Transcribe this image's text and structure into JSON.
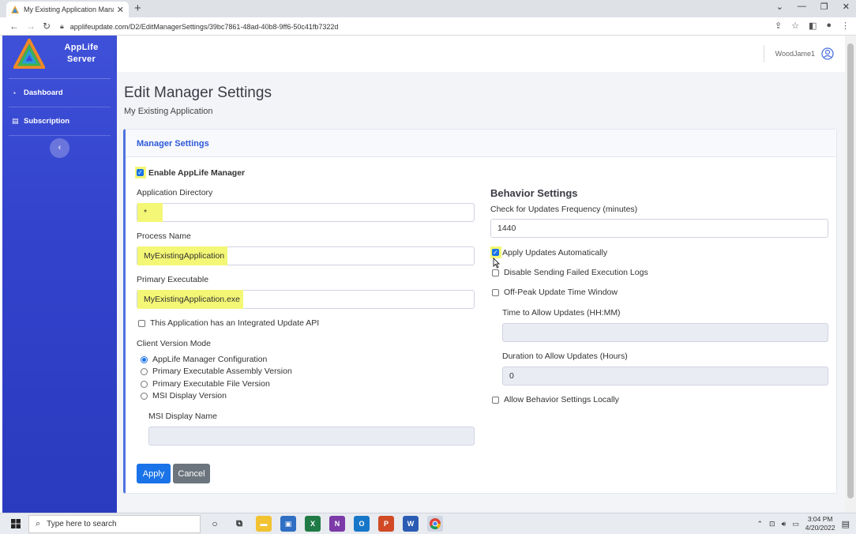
{
  "browser": {
    "tab_title": "My Existing Application Manager",
    "url": "applifeupdate.com/D2/EditManagerSettings/39bc7861-48ad-40b8-9ff6-50c41fb7322d"
  },
  "sidebar": {
    "brand_line1": "AppLife",
    "brand_line2": "Server",
    "items": [
      {
        "label": "Dashboard",
        "icon": "dashboard-icon"
      },
      {
        "label": "Subscription",
        "icon": "subscription-icon"
      }
    ],
    "collapse_glyph": "‹"
  },
  "topbar": {
    "username": "WoodJame1"
  },
  "page": {
    "title": "Edit Manager Settings",
    "subtitle": "My Existing Application"
  },
  "card": {
    "header": "Manager Settings",
    "enable_manager": {
      "label": "Enable AppLife Manager",
      "checked": true
    },
    "app_directory": {
      "label": "Application Directory",
      "value": "*"
    },
    "process_name": {
      "label": "Process Name",
      "value": "MyExistingApplication"
    },
    "primary_executable": {
      "label": "Primary Executable",
      "value": "MyExistingApplication.exe"
    },
    "integrated_api": {
      "label": "This Application has an Integrated Update API",
      "checked": false
    },
    "client_version_mode": {
      "label": "Client Version Mode",
      "options": [
        {
          "label": "AppLife Manager Configuration",
          "selected": true
        },
        {
          "label": "Primary Executable Assembly Version",
          "selected": false
        },
        {
          "label": "Primary Executable File Version",
          "selected": false
        },
        {
          "label": "MSI Display Version",
          "selected": false
        }
      ]
    },
    "msi_display_name": {
      "label": "MSI Display Name",
      "value": ""
    },
    "behavior": {
      "title": "Behavior Settings",
      "check_frequency": {
        "label": "Check for Updates Frequency (minutes)",
        "value": "1440"
      },
      "apply_auto": {
        "label": "Apply Updates Automatically",
        "checked": true
      },
      "disable_logs": {
        "label": "Disable Sending Failed Execution Logs",
        "checked": false
      },
      "offpeak": {
        "label": "Off-Peak Update Time Window",
        "checked": false
      },
      "time_allow": {
        "label": "Time to Allow Updates (HH:MM)",
        "value": ""
      },
      "duration_allow": {
        "label": "Duration to Allow Updates (Hours)",
        "value": "0"
      },
      "allow_local": {
        "label": "Allow Behavior Settings Locally",
        "checked": false
      }
    },
    "apply_label": "Apply",
    "cancel_label": "Cancel"
  },
  "taskbar": {
    "search_placeholder": "Type here to search",
    "time": "3:04 PM",
    "date": "4/20/2022"
  },
  "colors": {
    "sidebar": "#3343cc",
    "primary": "#1a73e8",
    "highlight": "#f4f775"
  }
}
